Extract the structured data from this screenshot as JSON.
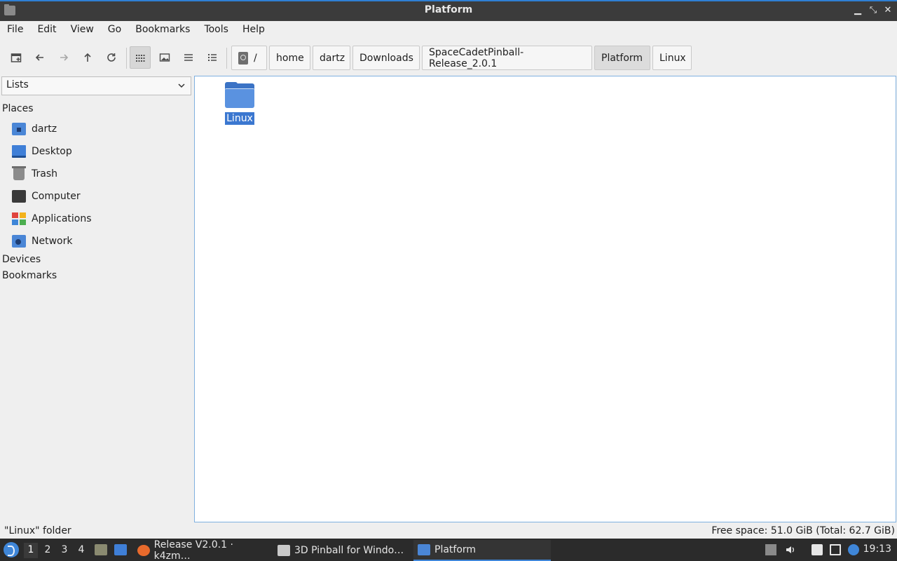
{
  "window": {
    "title": "Platform",
    "controls": {
      "minimize": "▁",
      "maximize": "⤡",
      "close": "✕"
    }
  },
  "menu": [
    "File",
    "Edit",
    "View",
    "Go",
    "Bookmarks",
    "Tools",
    "Help"
  ],
  "toolbar": {
    "icons": [
      "new-tab-icon",
      "back-icon",
      "forward-icon",
      "up-icon",
      "reload-icon",
      "icon-view-icon",
      "thumbnail-view-icon",
      "compact-view-icon",
      "detailed-list-icon"
    ],
    "breadcrumbs": [
      "/",
      "home",
      "dartz",
      "Downloads",
      "SpaceCadetPinball-Release_2.0.1",
      "Platform",
      "Linux"
    ]
  },
  "sidebar": {
    "selector": "Lists",
    "places_heading": "Places",
    "places": [
      "dartz",
      "Desktop",
      "Trash",
      "Computer",
      "Applications",
      "Network"
    ],
    "devices_heading": "Devices",
    "bookmarks_heading": "Bookmarks"
  },
  "files": [
    {
      "name": "Linux",
      "type": "folder",
      "selected": true
    }
  ],
  "status": {
    "left": "\"Linux\" folder",
    "right": "Free space: 51.0 GiB (Total: 62.7 GiB)"
  },
  "taskbar": {
    "workspaces": [
      "1",
      "2",
      "3",
      "4"
    ],
    "active_workspace": "1",
    "tasks": [
      "Release V2.0.1 · k4zm…",
      "3D Pinball for Windo…",
      "Platform"
    ],
    "clock": "19:13"
  },
  "colors": {
    "accent": "#3b77d0",
    "titlebar": "#3b3b3b",
    "taskbar": "#2b2b2b"
  }
}
